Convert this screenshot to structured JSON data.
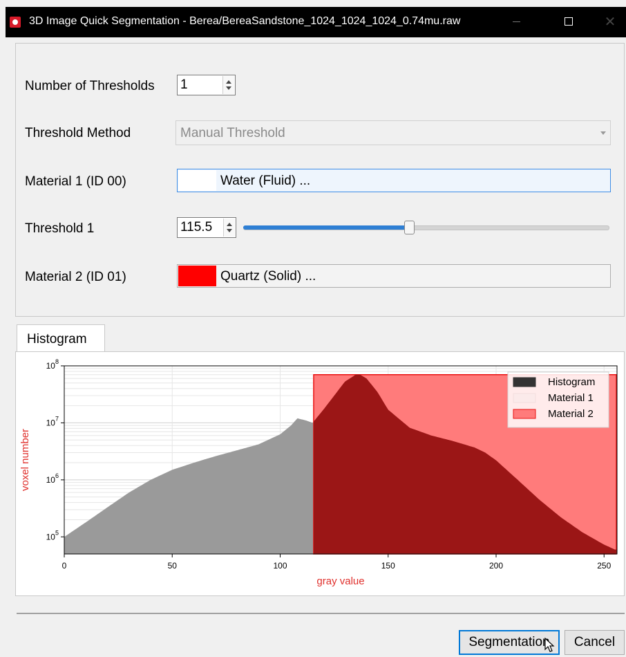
{
  "window": {
    "title": "3D Image Quick Segmentation - Berea/BereaSandstone_1024_1024_1024_0.74mu.raw",
    "icon": "app-icon",
    "controls": [
      "minimize-icon",
      "maximize-icon",
      "close-icon"
    ]
  },
  "settings": {
    "num_thresholds_label": "Number of Thresholds",
    "num_thresholds_value": "1",
    "method_label": "Threshold Method",
    "method_value": "Manual Threshold",
    "material1_label": "Material 1 (ID 00)",
    "material1_button": "Water (Fluid) ...",
    "material1_color": "#ffffff",
    "threshold1_label": "Threshold 1",
    "threshold1_value": "115.5",
    "threshold1_slider_fraction": 0.453,
    "material2_label": "Material 2 (ID 01)",
    "material2_button": "Quartz (Solid) ...",
    "material2_color": "#ff0000"
  },
  "tabs": [
    {
      "label": "Histogram",
      "active": true
    }
  ],
  "chart_data": {
    "type": "area",
    "xlabel": "gray value",
    "ylabel": "voxel number",
    "xlim": [
      0,
      256
    ],
    "ylim_log10": [
      4.7,
      8
    ],
    "y_scale": "log",
    "xticks": [
      "0",
      "50",
      "100",
      "150",
      "200",
      "250"
    ],
    "yticks": [
      {
        "base": "10",
        "exp": "5"
      },
      {
        "base": "10",
        "exp": "6"
      },
      {
        "base": "10",
        "exp": "7"
      },
      {
        "base": "10",
        "exp": "8"
      }
    ],
    "threshold": 115.5,
    "material2_band_top": 70000000,
    "legend": {
      "position": "top-right",
      "entries": [
        "Histogram",
        "Material 1",
        "Material 2"
      ]
    },
    "colors": {
      "histogram": "#333333",
      "material1_region": "#9a9a9a",
      "material2_fill": "#ff7b7b",
      "material2_edge": "#e81010",
      "overlap": "#9b1616",
      "axis_label": "#e0312d"
    },
    "grid": true,
    "series": [
      {
        "name": "Histogram",
        "x": [
          0,
          10,
          20,
          30,
          40,
          50,
          60,
          70,
          80,
          90,
          100,
          105,
          108,
          112,
          115,
          120,
          125,
          130,
          135,
          137,
          140,
          145,
          150,
          160,
          170,
          180,
          190,
          195,
          200,
          210,
          220,
          230,
          240,
          250,
          255
        ],
        "y": [
          100000,
          180000,
          330000,
          600000,
          1000000,
          1500000,
          2000000,
          2600000,
          3300000,
          4200000,
          6300000,
          9000000,
          12000000,
          11000000,
          10000000,
          17000000,
          30000000,
          53000000,
          70000000,
          70000000,
          60000000,
          35000000,
          17000000,
          8200000,
          6000000,
          4800000,
          3700000,
          3000000,
          2200000,
          1000000,
          450000,
          220000,
          120000,
          73000,
          60000
        ]
      }
    ]
  },
  "buttons": {
    "segmentation": "Segmentation",
    "cancel": "Cancel"
  }
}
